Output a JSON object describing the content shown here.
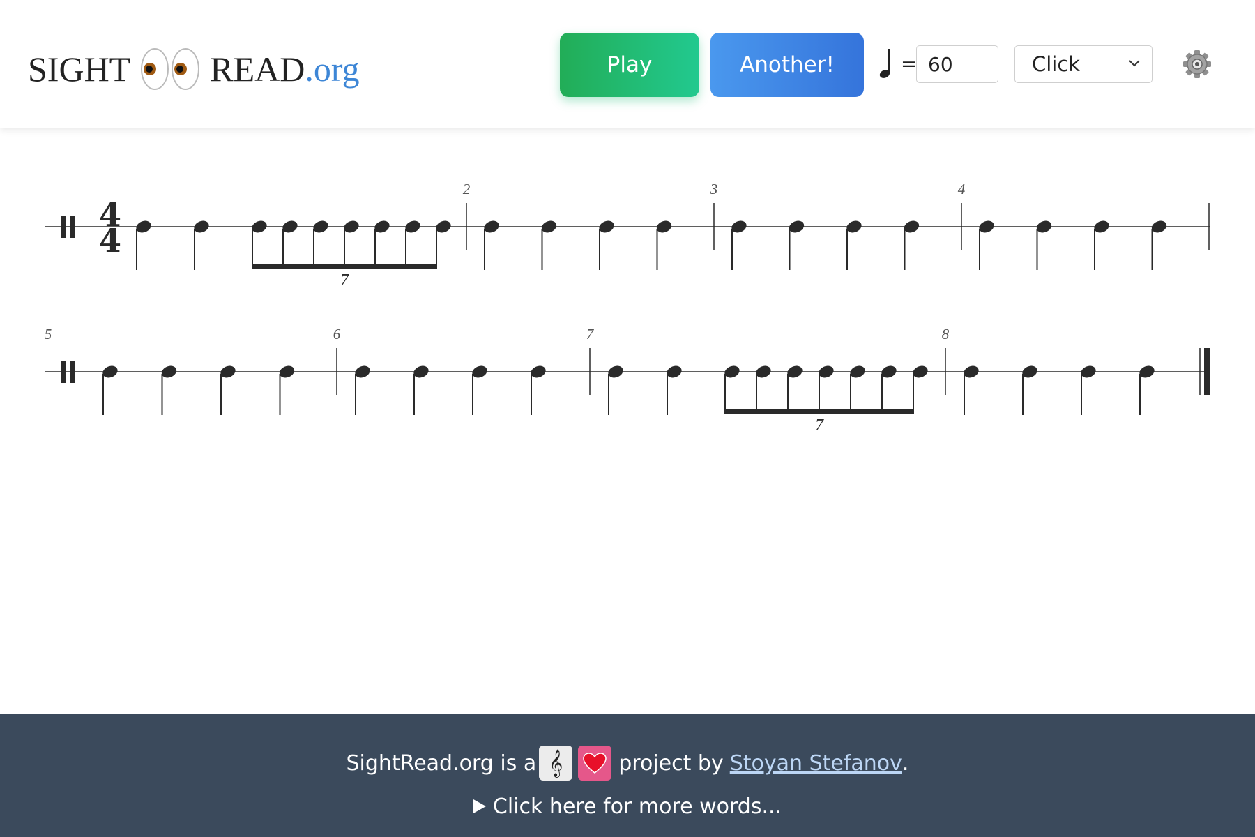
{
  "logo": {
    "sight": "SIGHT",
    "read": "READ",
    "org": ".org"
  },
  "toolbar": {
    "play_label": "Play",
    "another_label": "Another!",
    "tempo_equals": "=",
    "tempo_value": "60",
    "sound_selected": "Click"
  },
  "score": {
    "time_signature": {
      "top": "4",
      "bottom": "4"
    },
    "lines": [
      {
        "measures": [
          {
            "number": "",
            "notes": [
              "q",
              "q",
              "septuplet"
            ]
          },
          {
            "number": "2",
            "notes": [
              "q",
              "q",
              "q",
              "q"
            ]
          },
          {
            "number": "3",
            "notes": [
              "q",
              "q",
              "q",
              "q"
            ]
          },
          {
            "number": "4",
            "notes": [
              "q",
              "q",
              "q",
              "q"
            ]
          }
        ]
      },
      {
        "measures": [
          {
            "number": "5",
            "notes": [
              "q",
              "q",
              "q",
              "q"
            ]
          },
          {
            "number": "6",
            "notes": [
              "q",
              "q",
              "q",
              "q"
            ]
          },
          {
            "number": "7",
            "notes": [
              "q",
              "q",
              "septuplet"
            ]
          },
          {
            "number": "8",
            "notes": [
              "q",
              "q",
              "q",
              "q"
            ]
          }
        ]
      }
    ],
    "tuplet_label": "7"
  },
  "footer": {
    "text_before": "SightRead.org is a",
    "text_after": "project by",
    "author": "Stoyan Stefanov",
    "period": ".",
    "clef_glyph": "𝄞",
    "more_words": "Click here for more words..."
  },
  "colors": {
    "play": "#22b36d",
    "another": "#3f86e4",
    "footer_bg": "#3b4a5c",
    "org": "#3d86d6"
  }
}
